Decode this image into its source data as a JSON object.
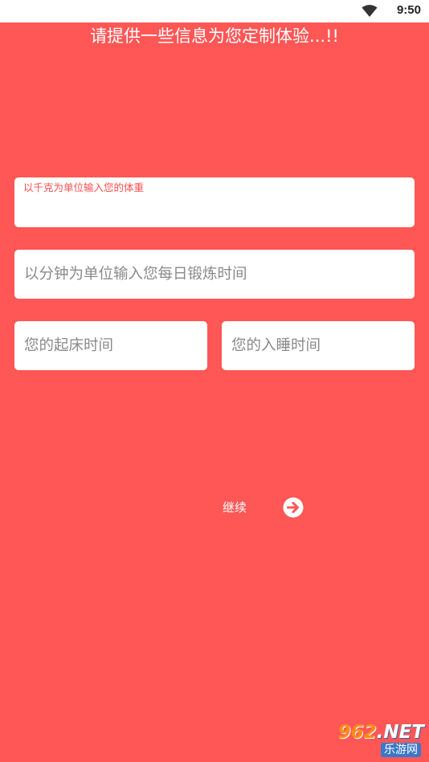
{
  "status_bar": {
    "time": "9:50",
    "wifi_icon": "wifi-icon"
  },
  "header": {
    "title": "请提供一些信息为您定制体验...!!"
  },
  "form": {
    "weight": {
      "label": "以千克为单位输入您的体重",
      "value": ""
    },
    "exercise": {
      "placeholder": "以分钟为单位输入您每日锻炼时间"
    },
    "wake_time": {
      "placeholder": "您的起床时间"
    },
    "sleep_time": {
      "placeholder": "您的入睡时间"
    }
  },
  "actions": {
    "continue_label": "继续",
    "continue_icon": "arrow-right-circle-icon"
  },
  "watermark": {
    "number": "962",
    "domain": ".NET",
    "site_name": "乐游网"
  },
  "colors": {
    "background": "#ff5656",
    "label_accent": "#ff4d4d",
    "text_on_background": "#ffffff",
    "placeholder": "#8a8a8a"
  }
}
